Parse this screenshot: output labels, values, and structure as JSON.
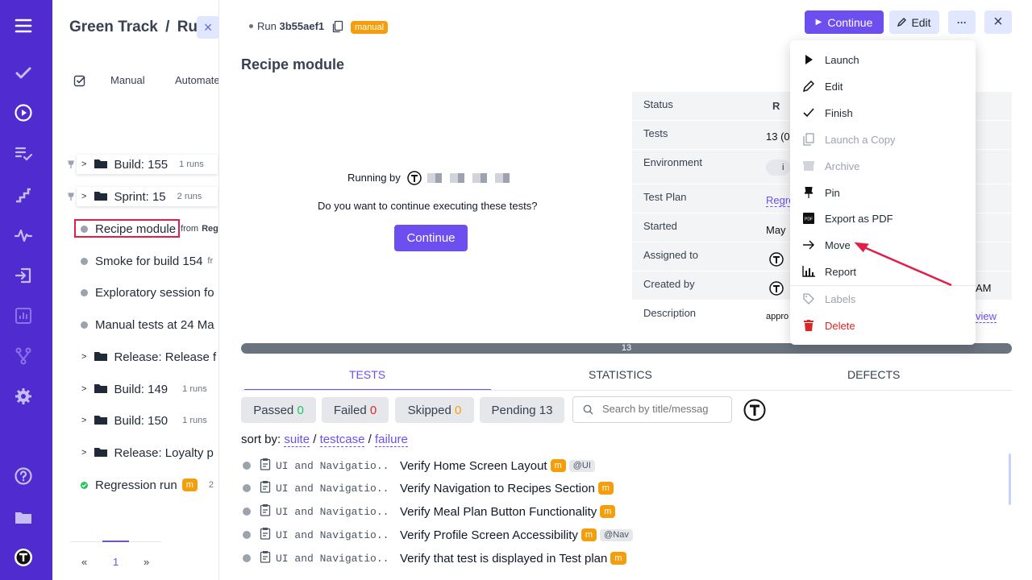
{
  "colors": {
    "sidebar": "#4f2bd0",
    "accent": "#6d4ff0",
    "badge": "#f59e0b",
    "danger": "#dc2626",
    "success": "#22c55e"
  },
  "sidebar": {
    "icons": [
      "menu-icon",
      "check-icon",
      "play-circle-icon",
      "list-check-icon",
      "steps-icon",
      "pulse-icon",
      "import-icon",
      "bar-chart-icon",
      "branch-icon",
      "gear-icon",
      "help-icon",
      "folder-icon",
      "testomat-logo-icon"
    ]
  },
  "left": {
    "project": "Green Track",
    "sep": "/",
    "section": "Rur",
    "tabs": {
      "manual": "Manual",
      "automated": "Automate"
    },
    "tree": [
      {
        "label": "Build: 155",
        "meta": "1 runs",
        "kind": "folder"
      },
      {
        "label": "Sprint: 15",
        "meta": "2 runs",
        "kind": "folder"
      },
      {
        "label": "Recipe module",
        "meta": "from",
        "meta2": "Reg",
        "kind": "run"
      },
      {
        "label": "Smoke for build 154",
        "meta": "fr",
        "kind": "run"
      },
      {
        "label": "Exploratory session fo",
        "meta": "",
        "kind": "run"
      },
      {
        "label": "Manual tests at 24 Ma",
        "meta": "",
        "kind": "run"
      },
      {
        "label": "Release: Release f",
        "meta": "",
        "kind": "folder"
      },
      {
        "label": "Build: 149",
        "meta": "1 runs",
        "kind": "folder"
      },
      {
        "label": "Build: 150",
        "meta": "1 runs",
        "kind": "folder"
      },
      {
        "label": "Release: Loyalty p",
        "meta": "",
        "kind": "folder"
      },
      {
        "label": "Regression run",
        "meta": "m",
        "meta2": "2",
        "kind": "passed"
      }
    ],
    "pager": {
      "prev": "«",
      "page": "1",
      "next": "»"
    }
  },
  "header": {
    "run_label": "Run",
    "run_id": "3b55aef1",
    "badge": "manual",
    "continue": "Continue",
    "edit": "Edit",
    "more": "···",
    "close": "×"
  },
  "title": "Recipe module",
  "running": {
    "label": "Running by",
    "question": "Do you want to continue executing these tests?",
    "button": "Continue"
  },
  "details": {
    "rows": [
      {
        "key": "Status",
        "val": "R"
      },
      {
        "key": "Tests",
        "val": "13 (0"
      },
      {
        "key": "Environment",
        "val": "i"
      },
      {
        "key": "Test Plan",
        "val": "Regre"
      },
      {
        "key": "Started",
        "val": "May"
      },
      {
        "key": "Assigned to",
        "val": ""
      },
      {
        "key": "Created by",
        "val": "AM"
      },
      {
        "key": "Description",
        "val": "appro",
        "val2": "view"
      }
    ]
  },
  "menu": {
    "items": [
      {
        "label": "Launch",
        "icon": "play-icon",
        "state": "normal"
      },
      {
        "label": "Edit",
        "icon": "pencil-icon",
        "state": "normal"
      },
      {
        "label": "Finish",
        "icon": "check-icon",
        "state": "normal"
      },
      {
        "label": "Launch a Copy",
        "icon": "copy-icon",
        "state": "disabled"
      },
      {
        "label": "Archive",
        "icon": "archive-icon",
        "state": "disabled"
      },
      {
        "label": "Pin",
        "icon": "pin-icon",
        "state": "normal"
      },
      {
        "label": "Export as PDF",
        "icon": "pdf-icon",
        "state": "normal"
      },
      {
        "label": "Move",
        "icon": "arrow-right-icon",
        "state": "normal"
      },
      {
        "label": "Report",
        "icon": "bar-chart-icon",
        "state": "normal"
      },
      {
        "label": "Labels",
        "icon": "tag-icon",
        "state": "disabled"
      },
      {
        "label": "Delete",
        "icon": "trash-icon",
        "state": "danger"
      }
    ]
  },
  "progress": {
    "total": "13"
  },
  "tabs": {
    "tests": "TESTS",
    "statistics": "STATISTICS",
    "defects": "DEFECTS"
  },
  "filters": {
    "passed": "Passed",
    "passed_n": "0",
    "failed": "Failed",
    "failed_n": "0",
    "skipped": "Skipped",
    "skipped_n": "0",
    "pending": "Pending",
    "pending_n": "13",
    "search_placeholder": "Search by title/messag"
  },
  "sort": {
    "label": "sort by:",
    "suite": "suite",
    "testcase": "testcase",
    "failure": "failure",
    "sep": "/"
  },
  "tests": [
    {
      "suite": "UI and Navigatio...",
      "title": "Verify Home Screen Layout",
      "badge": "m",
      "tag": "@UI"
    },
    {
      "suite": "UI and Navigatio...",
      "title": "Verify Navigation to Recipes Section",
      "badge": "m",
      "tag": ""
    },
    {
      "suite": "UI and Navigatio...",
      "title": "Verify Meal Plan Button Functionality",
      "badge": "m",
      "tag": ""
    },
    {
      "suite": "UI and Navigatio...",
      "title": "Verify Profile Screen Accessibility",
      "badge": "m",
      "tag": "@Nav"
    },
    {
      "suite": "UI and Navigatio...",
      "title": "Verify that test is displayed in Test plan",
      "badge": "m",
      "tag": ""
    }
  ]
}
